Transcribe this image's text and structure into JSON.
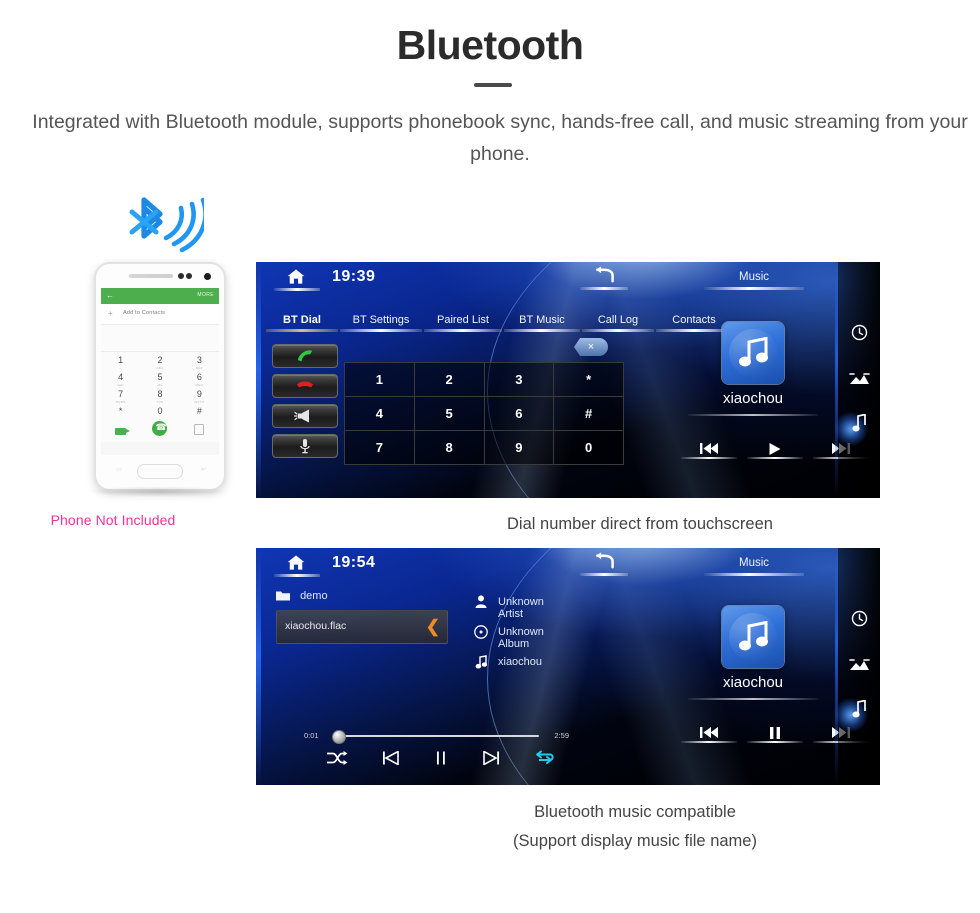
{
  "header": {
    "title": "Bluetooth",
    "subtitle": "Integrated with  Bluetooth module, supports phonebook sync, hands-free call, and music streaming from your phone."
  },
  "phone_illustration": {
    "bluetooth_icon": "bluetooth-signal-icon",
    "app_bar": {
      "back": "←",
      "more": "MORE"
    },
    "add_contacts_label": "Add to Contacts",
    "keypad": [
      {
        "num": "1",
        "sub": "∞"
      },
      {
        "num": "2",
        "sub": "ABC"
      },
      {
        "num": "3",
        "sub": "DEF"
      },
      {
        "num": "4",
        "sub": "GHI"
      },
      {
        "num": "5",
        "sub": "JKL"
      },
      {
        "num": "6",
        "sub": "MNO"
      },
      {
        "num": "7",
        "sub": "PQRS"
      },
      {
        "num": "8",
        "sub": "TUV"
      },
      {
        "num": "9",
        "sub": "WXYZ"
      },
      {
        "num": "*",
        "sub": ""
      },
      {
        "num": "0",
        "sub": "+"
      },
      {
        "num": "#",
        "sub": ""
      }
    ],
    "actions": [
      "video-call-icon",
      "call-icon",
      "keypad-hide-icon"
    ],
    "disclaimer": "Phone Not Included",
    "disclaimer_color": "#ee3399"
  },
  "screen_dial": {
    "clock": "19:39",
    "home_icon": "home-icon",
    "back_icon": "back-arrow-icon",
    "music_label": "Music",
    "tabs": [
      {
        "label": "BT Dial",
        "active": true
      },
      {
        "label": "BT Settings",
        "active": false
      },
      {
        "label": "Paired List",
        "active": false
      },
      {
        "label": "BT Music",
        "active": false
      },
      {
        "label": "Call Log",
        "active": false
      },
      {
        "label": "Contacts",
        "active": false
      }
    ],
    "call_buttons": [
      "answer-call-icon",
      "end-call-icon",
      "speaker-icon",
      "microphone-icon"
    ],
    "delete_key": "×",
    "dialpad": [
      [
        "1",
        "2",
        "3",
        "*"
      ],
      [
        "4",
        "5",
        "6",
        "#"
      ],
      [
        "7",
        "8",
        "9",
        "0"
      ]
    ],
    "now_playing": "xiaochou",
    "transport": [
      "prev-track-icon",
      "play-icon",
      "next-track-icon"
    ],
    "rail": [
      "clock-icon",
      "photo-icon",
      "music-note-icon"
    ],
    "rail_active_index": 2,
    "caption": "Dial number direct from touchscreen"
  },
  "screen_music": {
    "clock": "19:54",
    "home_icon": "home-icon",
    "back_icon": "back-arrow-icon",
    "music_label": "Music",
    "folder": "demo",
    "file": "xiaochou.flac",
    "metadata": [
      {
        "icon": "artist-icon",
        "text": "Unknown Artist"
      },
      {
        "icon": "album-icon",
        "text": "Unknown Album"
      },
      {
        "icon": "track-icon",
        "text": "xiaochou"
      }
    ],
    "time_elapsed": "0:01",
    "time_total": "2:59",
    "progress_percent": 1,
    "transport_bar": [
      "shuffle-icon",
      "prev-track-icon",
      "pause-icon",
      "next-track-icon",
      "repeat-icon"
    ],
    "repeat_active": true,
    "now_playing": "xiaochou",
    "player_controls": [
      "prev-track-icon",
      "pause-icon",
      "next-track-icon"
    ],
    "rail": [
      "clock-icon",
      "photo-icon",
      "music-note-icon"
    ],
    "rail_active_index": 2,
    "caption_line1": "Bluetooth music compatible",
    "caption_line2": "(Support display music file name)"
  }
}
